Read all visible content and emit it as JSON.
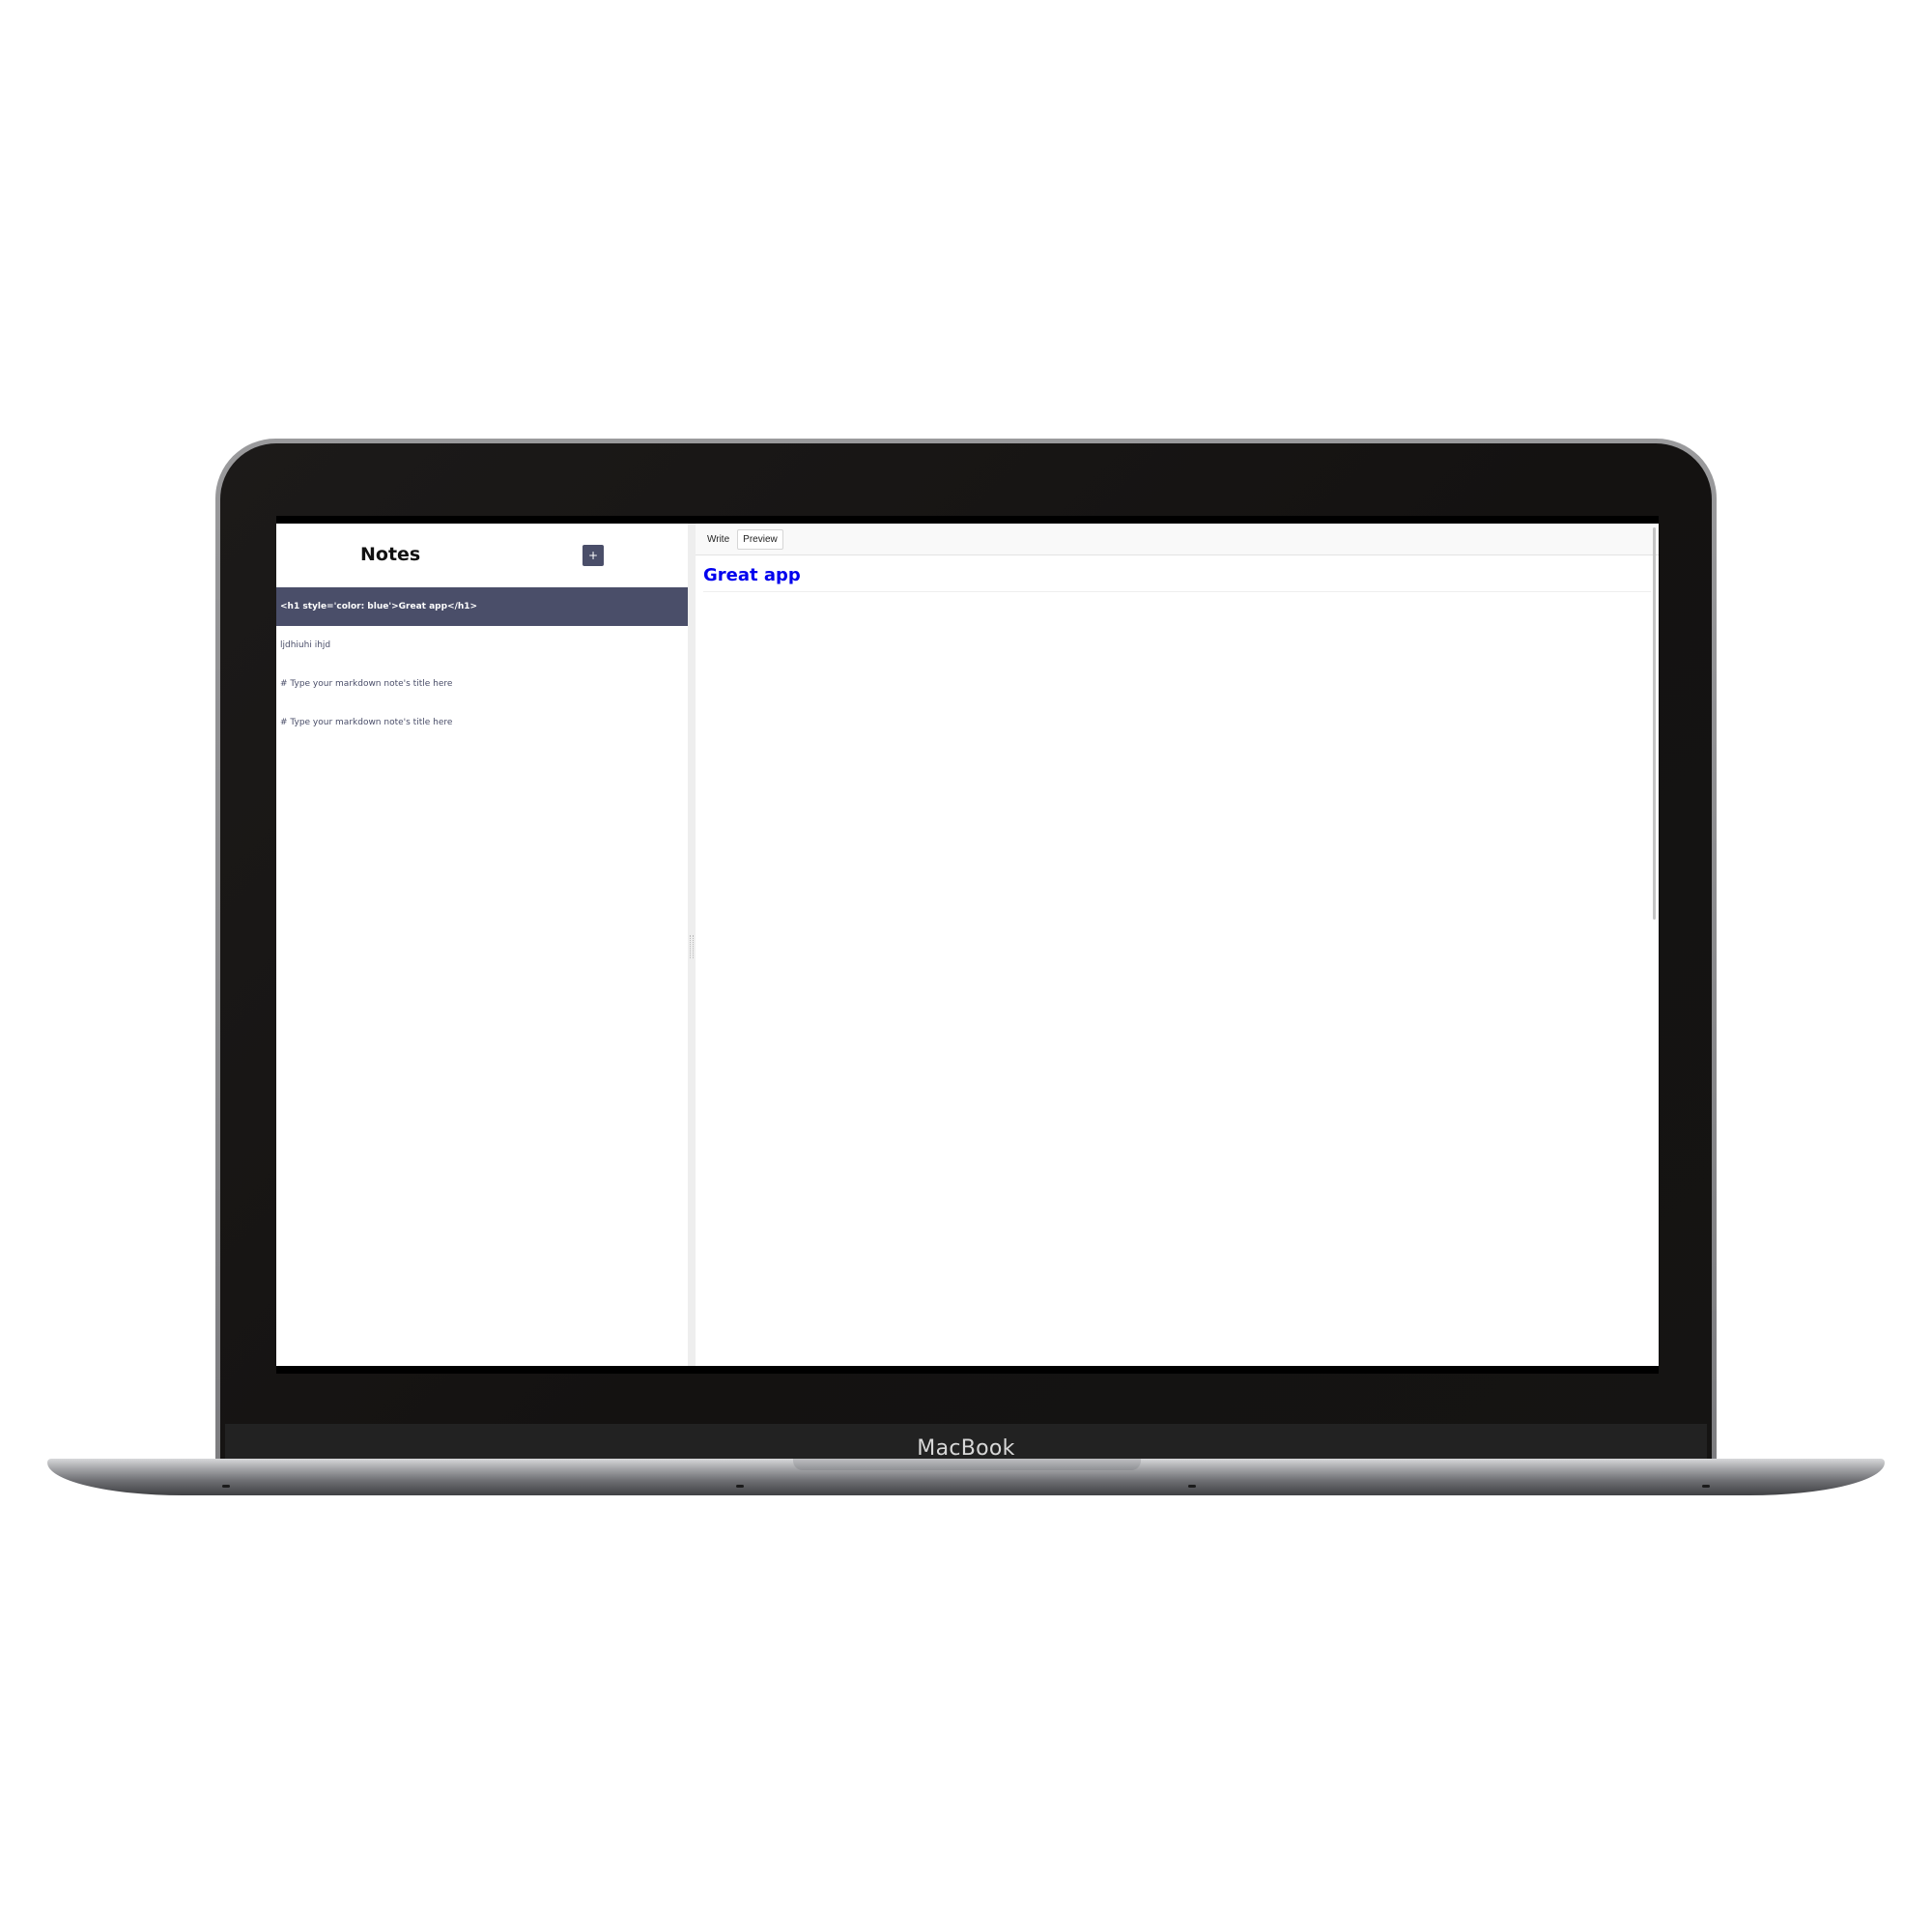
{
  "device": {
    "brand_label": "MacBook"
  },
  "sidebar": {
    "title": "Notes",
    "new_note_label": "+",
    "notes": [
      {
        "label": "<h1 style='color: blue'>Great app</h1>",
        "selected": true
      },
      {
        "label": "ljdhiuhi ihjd",
        "selected": false
      },
      {
        "label": "# Type your markdown note's title here",
        "selected": false
      },
      {
        "label": "# Type your markdown note's title here",
        "selected": false
      }
    ]
  },
  "editor": {
    "tabs": [
      {
        "label": "Write",
        "active": false
      },
      {
        "label": "Preview",
        "active": true
      }
    ],
    "preview": {
      "heading": "Great app",
      "heading_color": "#0000ee"
    }
  },
  "colors": {
    "accent": "#4a4e69",
    "preview_heading": "#0000ee"
  }
}
